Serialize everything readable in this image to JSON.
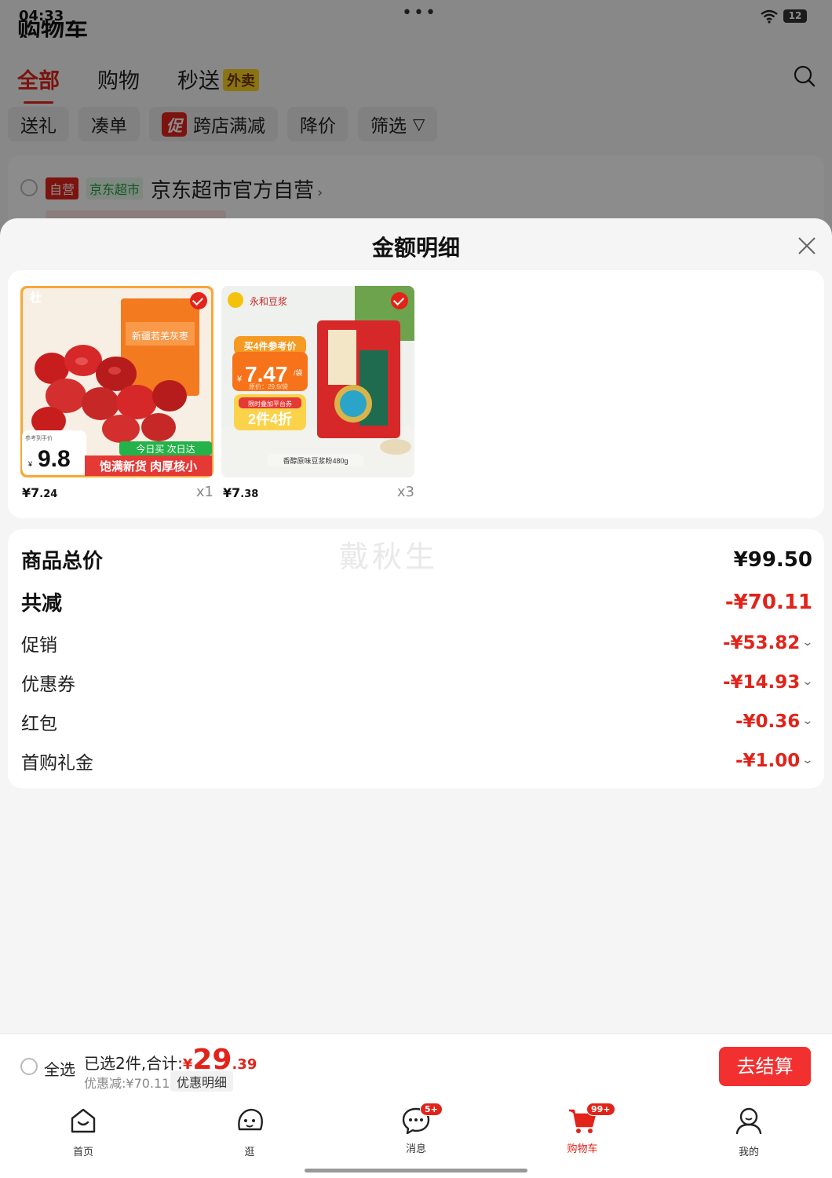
{
  "status_bar": {
    "time": "04:33",
    "battery": "12"
  },
  "background_page": {
    "tabs": [
      {
        "label": "全部",
        "active": true
      },
      {
        "label": "购物",
        "active": false
      },
      {
        "label": "秒送",
        "badge": "外卖",
        "active": false
      }
    ],
    "filters": [
      "送礼",
      "凑单",
      "跨店满减",
      "降价",
      "筛选"
    ],
    "promo_tag": "促",
    "shop": {
      "self_tag": "自营",
      "category_tag": "京东超市",
      "name": "京东超市官方自营"
    }
  },
  "sheet": {
    "title": "金额明细",
    "products": [
      {
        "price_int": "¥7",
        "price_dec": ".24",
        "qty": "x1",
        "image_label": "dates-product-image"
      },
      {
        "price_int": "¥7",
        "price_dec": ".38",
        "qty": "x3",
        "image_label": "soy-milk-powder-image"
      }
    ],
    "product1_art": {
      "brand": "杜",
      "bag_text": "新疆若羌灰枣",
      "ref_label": "参考到手价",
      "ref_yen": "¥",
      "ref_price": "9.8",
      "green_text": "今日买 次日达",
      "slogan": "饱满新货 肉厚核小"
    },
    "product2_art": {
      "brand": "永和豆浆",
      "buy_text": "买4件参考价",
      "price_yen": "¥",
      "price_big": "7.47",
      "price_unit": "/袋",
      "orig_price": "原价：29.9/袋",
      "limited": "限时叠加平台券",
      "discount": "2件4折",
      "footer": "香醇原味豆浆粉480g"
    },
    "watermark": "戴秋生",
    "summary": [
      {
        "label": "商品总价",
        "value": "¥99.50",
        "style": "total"
      },
      {
        "label": "共减",
        "value": "-¥70.11",
        "style": "discount-total"
      },
      {
        "label": "促销",
        "value": "-¥53.82",
        "expandable": true
      },
      {
        "label": "优惠券",
        "value": "-¥14.93",
        "expandable": true
      },
      {
        "label": "红包",
        "value": "-¥0.36",
        "expandable": true
      },
      {
        "label": "首购礼金",
        "value": "-¥1.00",
        "expandable": true
      }
    ]
  },
  "checkout": {
    "select_all": "全选",
    "selected_text": "已选2件,合计:",
    "total_yen": "¥",
    "total_int": "29",
    "total_dec": ".39",
    "discount_text": "优惠减:¥70.11",
    "discount_detail": "优惠明细",
    "checkout_button": "去结算"
  },
  "tab_bar": [
    {
      "label": "首页",
      "icon": "home-icon"
    },
    {
      "label": "逛",
      "icon": "browse-icon"
    },
    {
      "label": "消息",
      "icon": "message-icon",
      "badge": "5+"
    },
    {
      "label": "购物车",
      "icon": "cart-icon",
      "badge": "99+",
      "active": true
    },
    {
      "label": "我的",
      "icon": "profile-icon"
    }
  ],
  "colors": {
    "accent": "#e2231a",
    "checkout": "#f23030"
  }
}
